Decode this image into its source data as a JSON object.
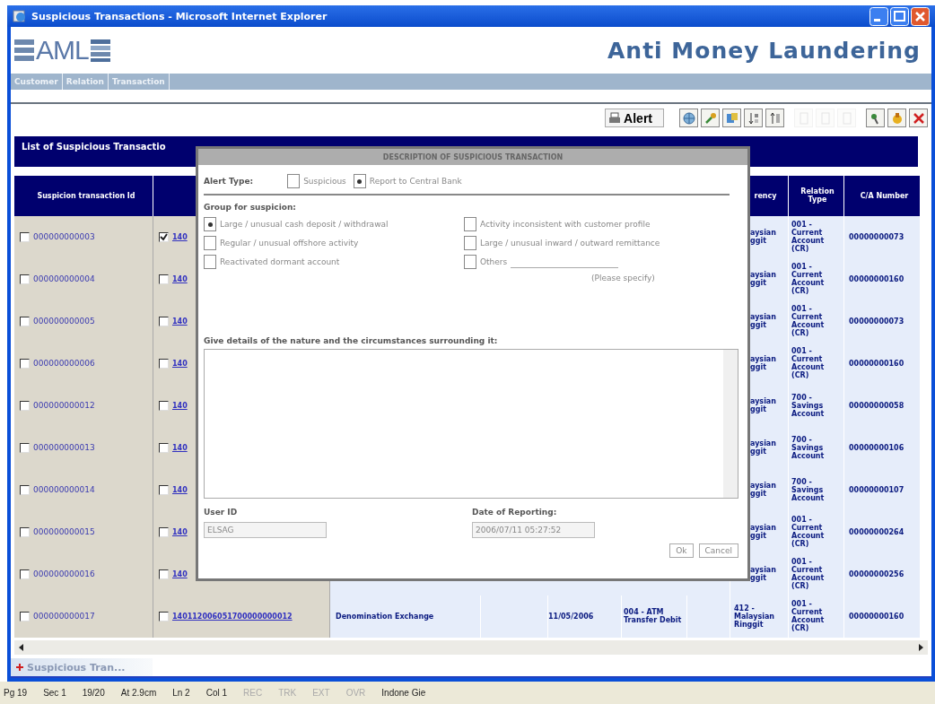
{
  "window": {
    "title": "Suspicious Transactions - Microsoft Internet Explorer"
  },
  "app": {
    "logo": "AML",
    "title": "Anti Money Laundering"
  },
  "nav_tabs": [
    "Customer",
    "Relation",
    "Transaction"
  ],
  "toolbar": {
    "alert_button": "Alert",
    "buttons": [
      {
        "kind": "globe",
        "disabled": false
      },
      {
        "kind": "key",
        "disabled": false
      },
      {
        "kind": "stack",
        "disabled": false
      },
      {
        "kind": "sort-asc",
        "disabled": false
      },
      {
        "kind": "sort-desc",
        "disabled": false
      },
      {
        "kind": "page",
        "disabled": true
      },
      {
        "kind": "page",
        "disabled": true
      },
      {
        "kind": "page",
        "disabled": true
      },
      {
        "kind": "filter",
        "disabled": false
      },
      {
        "kind": "lock",
        "disabled": false
      },
      {
        "kind": "close",
        "disabled": false
      }
    ]
  },
  "list_title": "List of Suspicious Transactio",
  "table": {
    "columns": {
      "column_1": "Suspicion transaction Id",
      "column_8": "rency",
      "column_9": "Relation Type",
      "column_10": "C/A Number"
    },
    "rows": [
      {
        "id": "000000000003",
        "id_checked": false,
        "ref_checked": true,
        "reference": "140",
        "currency": "aysian ggit",
        "relation_type": "001 - Current Account (CR)",
        "ca_number": "00000000073"
      },
      {
        "id": "000000000004",
        "id_checked": false,
        "ref_checked": false,
        "reference": "140",
        "currency": "aysian ggit",
        "relation_type": "001 - Current Account (CR)",
        "ca_number": "00000000160"
      },
      {
        "id": "000000000005",
        "id_checked": false,
        "ref_checked": false,
        "reference": "140",
        "currency": "aysian ggit",
        "relation_type": "001 - Current Account (CR)",
        "ca_number": "00000000073"
      },
      {
        "id": "000000000006",
        "id_checked": false,
        "ref_checked": false,
        "reference": "140",
        "currency": "aysian ggit",
        "relation_type": "001 - Current Account (CR)",
        "ca_number": "00000000160"
      },
      {
        "id": "000000000012",
        "id_checked": false,
        "ref_checked": false,
        "reference": "140",
        "currency": "aysian ggit",
        "relation_type": "700 - Savings Account",
        "ca_number": "00000000058"
      },
      {
        "id": "000000000013",
        "id_checked": false,
        "ref_checked": false,
        "reference": "140",
        "currency": "aysian ggit",
        "relation_type": "700 - Savings Account",
        "ca_number": "00000000106"
      },
      {
        "id": "000000000014",
        "id_checked": false,
        "ref_checked": false,
        "reference": "140",
        "currency": "aysian ggit",
        "relation_type": "700 - Savings Account",
        "ca_number": "00000000107"
      },
      {
        "id": "000000000015",
        "id_checked": false,
        "ref_checked": false,
        "reference": "140",
        "currency": "aysian ggit",
        "relation_type": "001 - Current Account (CR)",
        "ca_number": "00000000264"
      },
      {
        "id": "000000000016",
        "id_checked": false,
        "ref_checked": false,
        "reference": "140",
        "currency": "aysian ggit",
        "relation_type": "001 - Current Account (CR)",
        "ca_number": "00000000256"
      },
      {
        "id": "000000000017",
        "id_checked": false,
        "ref_checked": false,
        "reference": "140112006051700000000012",
        "description": "Denomination Exchange",
        "date": "11/05/2006",
        "transaction_type": "004 - ATM Transfer Debit",
        "currency": "412 - Malaysian Ringgit",
        "relation_type": "001 - Current Account (CR)",
        "ca_number": "00000000160"
      }
    ]
  },
  "dialog": {
    "title": "DESCRIPTION OF SUSPICIOUS TRANSACTION",
    "alert_type": {
      "label": "Alert Type:",
      "options": [
        {
          "label": "Suspicious",
          "selected": false
        },
        {
          "label": "Report to Central Bank",
          "selected": true
        }
      ]
    },
    "group": {
      "label": "Group for suspicion:",
      "options": [
        {
          "label": "Large / unusual cash deposit / withdrawal",
          "selected": true
        },
        {
          "label": "Activity inconsistent with customer profile",
          "selected": false
        },
        {
          "label": "Regular / unusual offshore activity",
          "selected": false
        },
        {
          "label": "Large / unusual inward / outward remittance",
          "selected": false
        },
        {
          "label": "Reactivated dormant account",
          "selected": false
        },
        {
          "label": "Others",
          "selected": false
        }
      ],
      "specify_hint": "(Please specify)"
    },
    "details_label": "Give details of the nature and the circumstances surrounding it:",
    "user_id": {
      "label": "User ID",
      "value": "ELSAG"
    },
    "date": {
      "label": "Date of Reporting:",
      "value": "2006/07/11 05:27:52"
    },
    "buttons": [
      "Ok",
      "Cancel"
    ]
  },
  "document_tab": "Suspicious Tran...",
  "status_bar": [
    "Pg 19",
    "Sec 1",
    "19/20",
    "At 2.9cm",
    "Ln 2",
    "Col 1",
    "REC",
    "TRK",
    "EXT",
    "OVR",
    "Indone Gie"
  ]
}
